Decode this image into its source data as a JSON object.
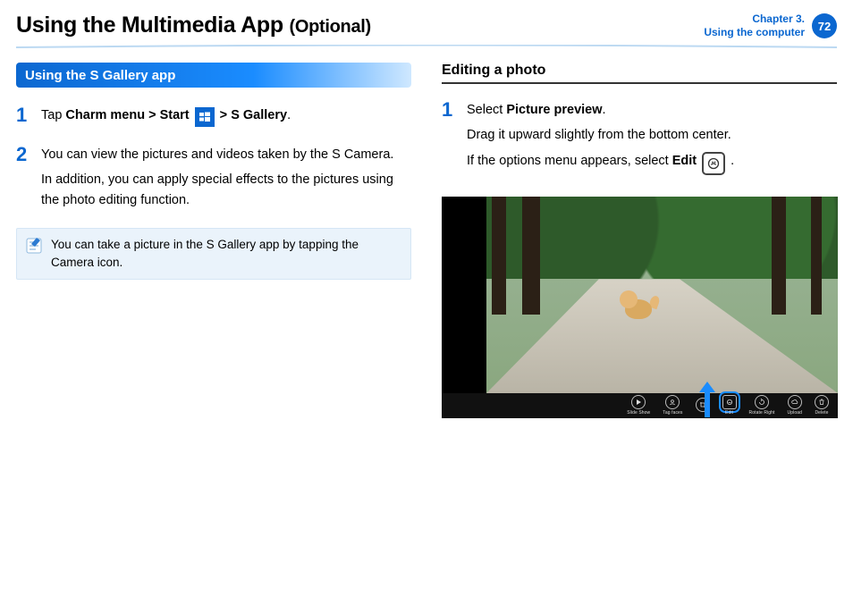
{
  "header": {
    "title_main": "Using the Multimedia App",
    "title_optional": "(Optional)",
    "chapter_line1": "Chapter 3.",
    "chapter_line2": "Using the computer",
    "page_number": "72"
  },
  "left": {
    "section_title": "Using the S Gallery app",
    "steps": [
      {
        "num": "1",
        "parts": {
          "tap": "Tap ",
          "charm_start": "Charm menu > Start",
          "gt1": " > ",
          "sgallery": "S Gallery",
          "period": "."
        }
      },
      {
        "num": "2",
        "p1": "You can view the pictures and videos taken by the S Camera.",
        "p2": "In addition, you can apply special effects to the pictures using the photo editing function."
      }
    ],
    "tip": "You can take a picture in the S Gallery app by tapping the Camera icon."
  },
  "right": {
    "h3": "Editing a photo",
    "step1": {
      "num": "1",
      "select": "Select ",
      "pp": "Picture preview",
      "period": ".",
      "drag": "Drag it upward slightly from the bottom center.",
      "if_pre": "If the options menu appears, select ",
      "edit": "Edit",
      "if_post": " ."
    },
    "toolbar": [
      {
        "name": "slideshow",
        "label": "Slide Show"
      },
      {
        "name": "tagfaces",
        "label": "Tag faces"
      },
      {
        "name": "crop",
        "label": ""
      },
      {
        "name": "edit",
        "label": "Edit",
        "highlight": true
      },
      {
        "name": "rotate",
        "label": "Rotate Right"
      },
      {
        "name": "upload",
        "label": "Upload"
      },
      {
        "name": "delete",
        "label": "Delete"
      }
    ]
  }
}
